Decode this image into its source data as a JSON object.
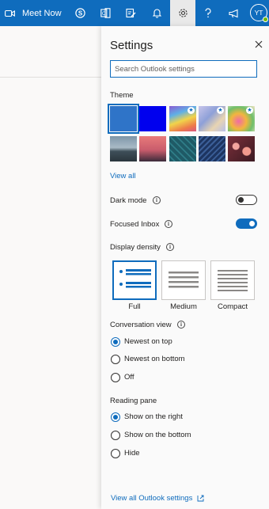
{
  "topbar": {
    "meet_now_label": "Meet Now",
    "avatar_initials": "YT",
    "colors": {
      "bar": "#0f6cbd",
      "presence": "#6bb700"
    }
  },
  "settings": {
    "title": "Settings",
    "search_placeholder": "Search Outlook settings",
    "theme": {
      "heading": "Theme",
      "view_all": "View all",
      "swatches": [
        "blue (selected)",
        "dark-blue",
        "rainbow",
        "abstract",
        "flowers",
        "mountain",
        "palms",
        "circuit",
        "pattern",
        "bokeh"
      ]
    },
    "dark_mode": {
      "label": "Dark mode",
      "on": false
    },
    "focused_inbox": {
      "label": "Focused Inbox",
      "on": true
    },
    "display_density": {
      "heading": "Display density",
      "options": [
        "Full",
        "Medium",
        "Compact"
      ],
      "selected": "Full"
    },
    "conversation_view": {
      "heading": "Conversation view",
      "options": [
        "Newest on top",
        "Newest on bottom",
        "Off"
      ],
      "selected": "Newest on top"
    },
    "reading_pane": {
      "heading": "Reading pane",
      "options": [
        "Show on the right",
        "Show on the bottom",
        "Hide"
      ],
      "selected": "Show on the right"
    },
    "footer_link": "View all Outlook settings"
  }
}
